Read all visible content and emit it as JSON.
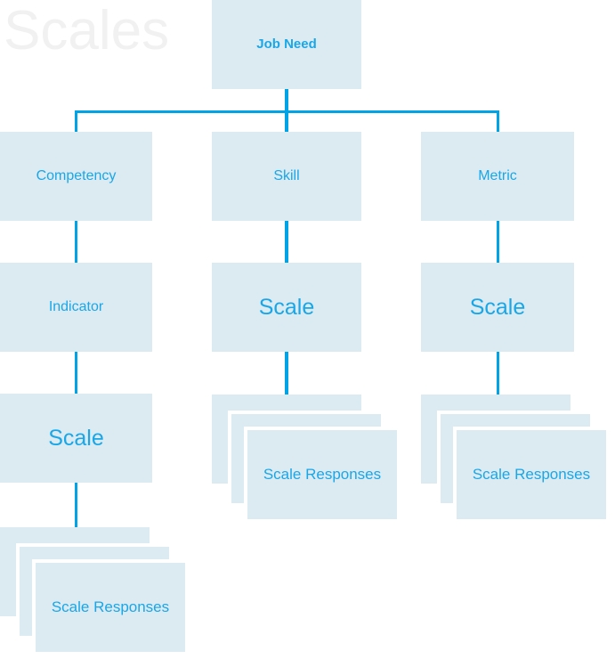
{
  "diagram": {
    "watermark": "Scales",
    "accent_color": "#19a7e8",
    "connector_color": "#00a3e6",
    "box_fill_color": "#dceaf2",
    "background_color": "#ffffff",
    "watermark_color": "#f1f1f1"
  },
  "nodes": {
    "root": {
      "label": "Job Need"
    },
    "branch_left": {
      "label": "Competency"
    },
    "branch_center": {
      "label": "Skill"
    },
    "branch_right": {
      "label": "Metric"
    },
    "left_indicator": {
      "label": "Indicator"
    },
    "center_scale": {
      "label": "Scale"
    },
    "right_scale": {
      "label": "Scale"
    },
    "left_scale": {
      "label": "Scale"
    },
    "left_responses": {
      "label": "Scale Responses"
    },
    "center_responses": {
      "label": "Scale Responses"
    },
    "right_responses": {
      "label": "Scale Responses"
    }
  }
}
